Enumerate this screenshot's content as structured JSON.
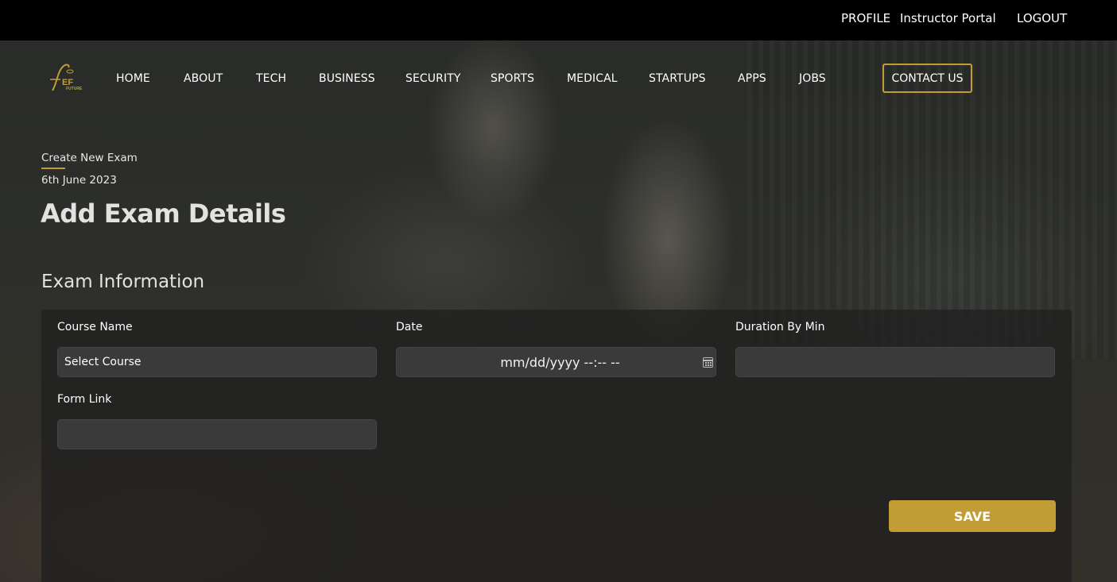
{
  "topbar": {
    "profile": "PROFILE",
    "portal": "Instructor Portal",
    "logout": "LOGOUT"
  },
  "logo": {
    "text": "EF",
    "subtext": "FUTURE"
  },
  "nav": {
    "items": [
      "HOME",
      "ABOUT",
      "TECH",
      "BUSINESS",
      "SECURITY",
      "SPORTS",
      "MEDICAL",
      "STARTUPS",
      "APPS",
      "JOBS"
    ],
    "contact": "CONTACT US"
  },
  "header": {
    "breadcrumb": "Create New Exam",
    "date": "6th June 2023",
    "title": "Add Exam Details"
  },
  "form": {
    "section_title": "Exam Information",
    "course_label": "Course Name",
    "course_value": "Select Course",
    "date_label": "Date",
    "date_placeholder": "mm/dd/yyyy --:-- --",
    "duration_label": "Duration By Min",
    "duration_value": "",
    "link_label": "Form Link",
    "link_value": "",
    "save_label": "SAVE"
  },
  "colors": {
    "accent": "#c29d35",
    "topbar": "#000000",
    "field_bg": "#3a3a3a"
  }
}
